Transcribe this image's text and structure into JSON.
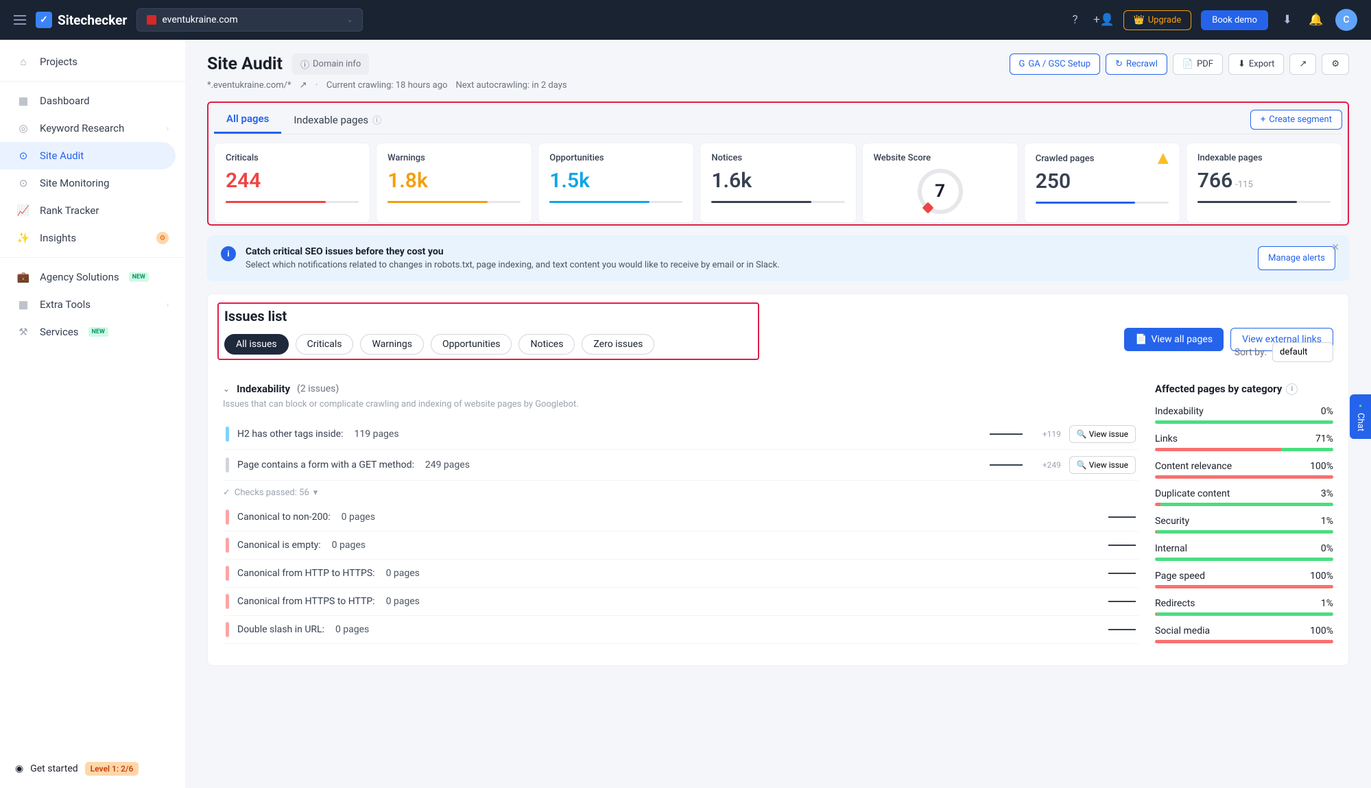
{
  "topbar": {
    "brand": "Sitechecker",
    "domain": "eventukraine.com",
    "upgrade": "Upgrade",
    "book": "Book demo",
    "avatar_letter": "C"
  },
  "sidebar": {
    "projects": "Projects",
    "items": [
      {
        "label": "Dashboard"
      },
      {
        "label": "Keyword Research"
      },
      {
        "label": "Site Audit"
      },
      {
        "label": "Site Monitoring"
      },
      {
        "label": "Rank Tracker"
      },
      {
        "label": "Insights"
      }
    ],
    "agency": "Agency Solutions",
    "extra": "Extra Tools",
    "services": "Services",
    "get_started": "Get started",
    "level": "Level 1: 2/6"
  },
  "header": {
    "title": "Site Audit",
    "domain_info": "Domain info",
    "breadcrumb": "*.eventukraine.com/*",
    "crawling": "Current crawling: 18 hours ago",
    "next": "Next autocrawling: in 2 days",
    "ga": "GA / GSC Setup",
    "recrawl": "Recrawl",
    "pdf": "PDF",
    "export": "Export"
  },
  "tabs": {
    "all": "All pages",
    "indexable": "Indexable pages",
    "create": "Create segment"
  },
  "cards": [
    {
      "title": "Criticals",
      "value": "244",
      "cls": "v-red",
      "lc": "#ef4444"
    },
    {
      "title": "Warnings",
      "value": "1.8k",
      "cls": "v-org",
      "lc": "#f59e0b"
    },
    {
      "title": "Opportunities",
      "value": "1.5k",
      "cls": "v-blu",
      "lc": "#0ea5e9"
    },
    {
      "title": "Notices",
      "value": "1.6k",
      "cls": "v-gry",
      "lc": "#374151"
    },
    {
      "title": "Website Score",
      "value": "7",
      "score": true
    },
    {
      "title": "Crawled pages",
      "value": "250",
      "cls": "v-gry",
      "lc": "#2563eb",
      "warn": true
    },
    {
      "title": "Indexable pages",
      "value": "766",
      "cls": "v-gry",
      "lc": "#374151",
      "sub": "-115"
    }
  ],
  "alert": {
    "title": "Catch critical SEO issues before they cost you",
    "desc": "Select which notifications related to changes in robots.txt, page indexing, and text content you would like to receive by email or in Slack.",
    "manage": "Manage alerts"
  },
  "issues": {
    "title": "Issues list",
    "view_all": "View all pages",
    "view_ext": "View external links",
    "filters": [
      "All issues",
      "Criticals",
      "Warnings",
      "Opportunities",
      "Notices",
      "Zero issues"
    ],
    "sort_label": "Sort by:",
    "sort_value": "default",
    "group": {
      "name": "Indexability",
      "count": "(2 issues)",
      "desc": "Issues that can block or complicate crawling and indexing of website pages by Googlebot."
    },
    "rows": [
      {
        "bar": "#7dd3fc",
        "label": "H2 has other tags inside:",
        "count": "119 pages",
        "delta": "+119",
        "view": "View issue"
      },
      {
        "bar": "#d1d5db",
        "label": "Page contains a form with a GET method:",
        "count": "249 pages",
        "delta": "+249",
        "view": "View issue"
      }
    ],
    "checks_passed": "Checks passed: 56",
    "simple": [
      {
        "label": "Canonical to non-200:",
        "count": "0 pages"
      },
      {
        "label": "Canonical is empty:",
        "count": "0 pages"
      },
      {
        "label": "Canonical from HTTP to HTTPS:",
        "count": "0 pages"
      },
      {
        "label": "Canonical from HTTPS to HTTP:",
        "count": "0 pages"
      },
      {
        "label": "Double slash in URL:",
        "count": "0 pages"
      }
    ]
  },
  "aside": {
    "title": "Affected pages by category",
    "cats": [
      {
        "name": "Indexability",
        "pct": "0%",
        "p": "0%"
      },
      {
        "name": "Links",
        "pct": "71%",
        "p": "71%"
      },
      {
        "name": "Content relevance",
        "pct": "100%",
        "p": "100%"
      },
      {
        "name": "Duplicate content",
        "pct": "3%",
        "p": "3%"
      },
      {
        "name": "Security",
        "pct": "1%",
        "p": "1%"
      },
      {
        "name": "Internal",
        "pct": "0%",
        "p": "0%"
      },
      {
        "name": "Page speed",
        "pct": "100%",
        "p": "100%"
      },
      {
        "name": "Redirects",
        "pct": "1%",
        "p": "1%"
      },
      {
        "name": "Social media",
        "pct": "100%",
        "p": "100%"
      }
    ]
  },
  "chat": "Chat"
}
